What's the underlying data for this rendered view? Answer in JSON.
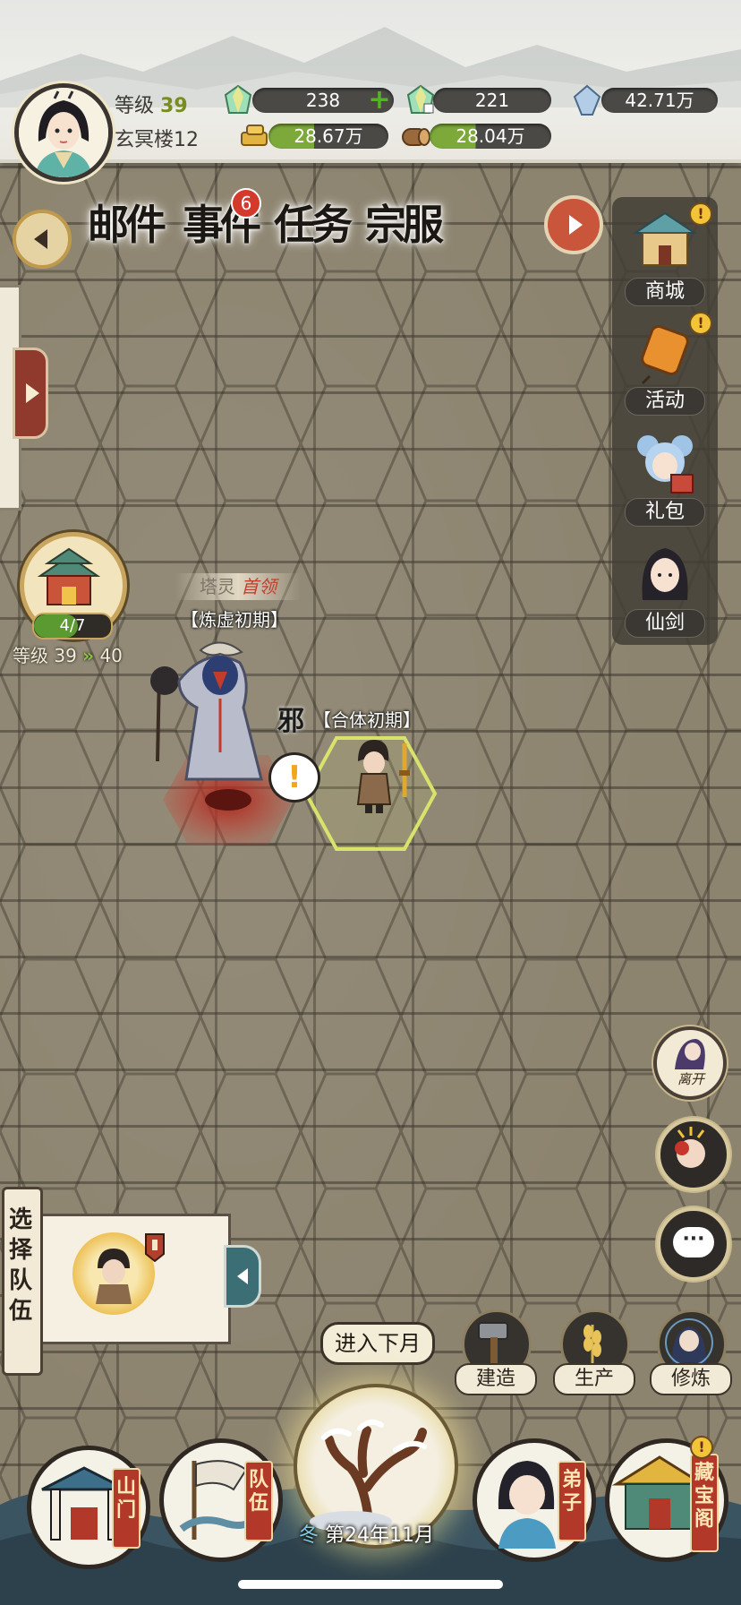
{
  "header": {
    "level_label": "等级",
    "level_value": "39",
    "tower_name": "玄冥楼12",
    "resources": {
      "spirit_stone_green": "238",
      "spirit_stone_locked": "221",
      "crystal": "42.71万",
      "gold": "28.67万",
      "wood": "28.04万"
    }
  },
  "tabs": {
    "mail": "邮件",
    "events": "事件",
    "events_badge": "6",
    "tasks": "任务",
    "sect_uniform": "宗服"
  },
  "side_menu": [
    {
      "label": "商城",
      "alert": "!"
    },
    {
      "label": "活动",
      "alert": "!"
    },
    {
      "label": "礼包"
    },
    {
      "label": "仙剑"
    }
  ],
  "pagoda": {
    "progress": "4/7",
    "progress_fraction": 0.57,
    "grade_label": "等级 39",
    "grade_arrow": "»",
    "grade_next": "40"
  },
  "board": {
    "boss_title_prefix": "塔灵",
    "boss_title_name": "首领",
    "boss_realm": "【炼虚初期】",
    "evil_mark": "邪",
    "hero_realm": "【合体初期】",
    "alert_mark": "!"
  },
  "right_buttons": {
    "leave_label": "离开",
    "chat_glyph": "···"
  },
  "team": {
    "select_label_1": "选择",
    "select_label_2": "队伍"
  },
  "actions": {
    "build": "建造",
    "produce": "生产",
    "cultivate": "修炼"
  },
  "bottom": {
    "next_month": "进入下月",
    "season": "冬",
    "date": "第24年11月",
    "nav": [
      {
        "label_1": "山",
        "label_2": "门"
      },
      {
        "label_1": "队",
        "label_2": "伍"
      },
      {
        "label_1": "弟",
        "label_2": "子"
      },
      {
        "label_1": "藏",
        "label_2": "宝",
        "label_3": "阁",
        "alert": "!"
      }
    ]
  },
  "colors": {
    "accent_green": "#7a8b20",
    "badge_red": "#d33a2b",
    "board_tile": "#8d8470"
  }
}
